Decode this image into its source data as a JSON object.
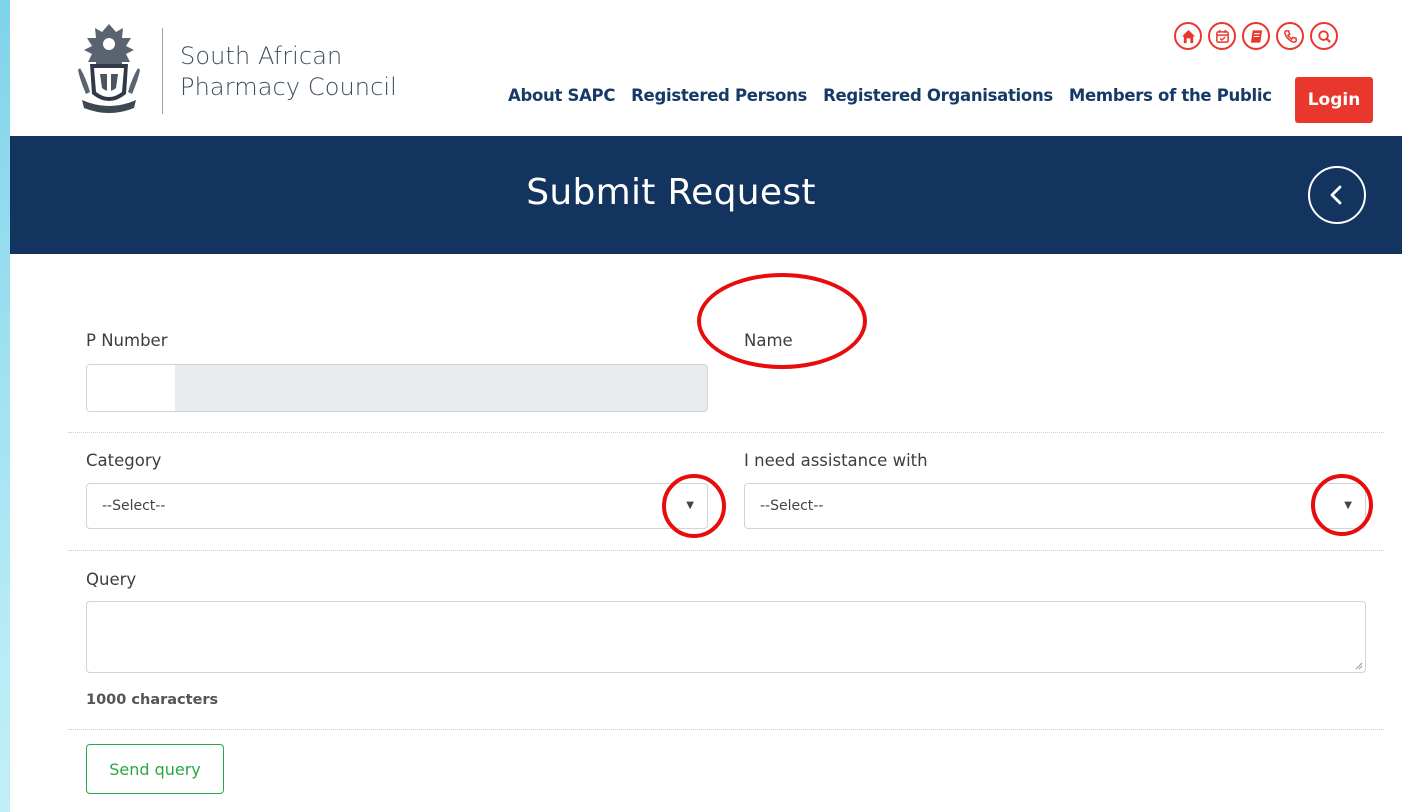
{
  "header": {
    "logo_line1": "South African",
    "logo_line2": "Pharmacy Council",
    "top_icons": [
      "home-icon",
      "calendar-icon",
      "book-icon",
      "phone-icon",
      "search-icon"
    ],
    "nav": [
      "About SAPC",
      "Registered Persons",
      "Registered Organisations",
      "Members of the Public"
    ],
    "login_label": "Login"
  },
  "banner": {
    "title": "Submit Request"
  },
  "form": {
    "p_number_label": "P Number",
    "name_label": "Name",
    "category_label": "Category",
    "category_value": "--Select--",
    "assistance_label": "I need assistance with",
    "assistance_value": "--Select--",
    "query_label": "Query",
    "char_limit": "1000 characters",
    "send_label": "Send query"
  },
  "colors": {
    "brand_navy": "#12345e",
    "accent_red": "#e8382d",
    "success_green": "#28a745",
    "annotation_red": "#e80d0d"
  }
}
